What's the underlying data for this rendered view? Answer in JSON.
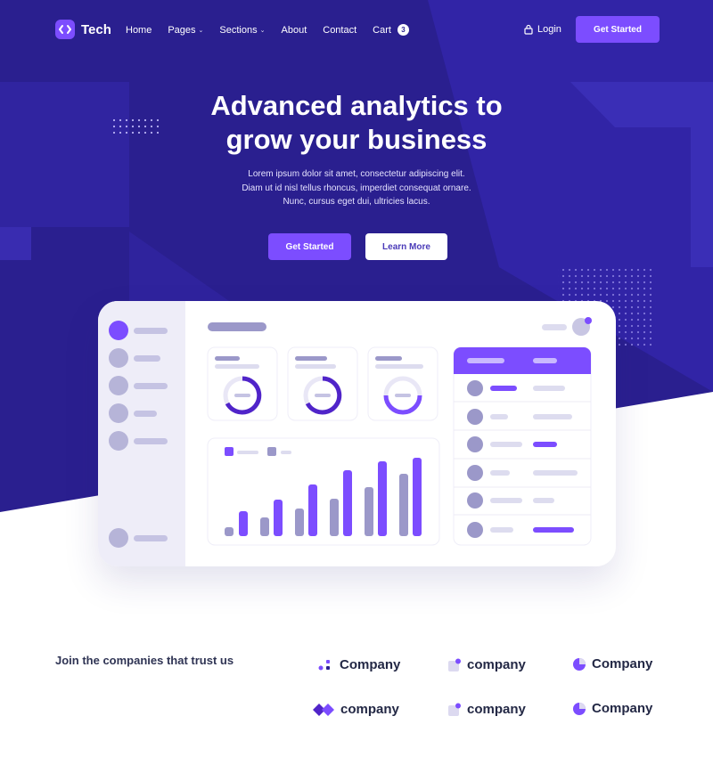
{
  "brand": {
    "name": "Tech",
    "icon": "code-brackets-icon"
  },
  "nav": {
    "links": [
      "Home",
      "Pages",
      "Sections",
      "About",
      "Contact",
      "Cart"
    ],
    "cart_count": "3",
    "login_label": "Login",
    "login_icon": "lock-icon",
    "cta_label": "Get Started"
  },
  "hero": {
    "title_line1": "Advanced analytics to",
    "title_line2": "grow your business",
    "sub_line1": "Lorem ipsum dolor sit amet, consectetur adipiscing elit.",
    "sub_line2": "Diam ut id nisl tellus rhoncus, imperdiet consequat ornare.",
    "sub_line3": "Nunc, cursus eget dui, ultricies lacus.",
    "primary_button": "Get Started",
    "secondary_button": "Learn More"
  },
  "companies": {
    "heading": "Join the companies that trust us",
    "logos": [
      "Company",
      "company",
      "Company",
      "company",
      "company",
      "Company"
    ]
  },
  "colors": {
    "hero_bg": "#2a1f8f",
    "accent": "#7c4dff",
    "muted_bar": "#9b98c9",
    "light_bar": "#dddcef"
  }
}
